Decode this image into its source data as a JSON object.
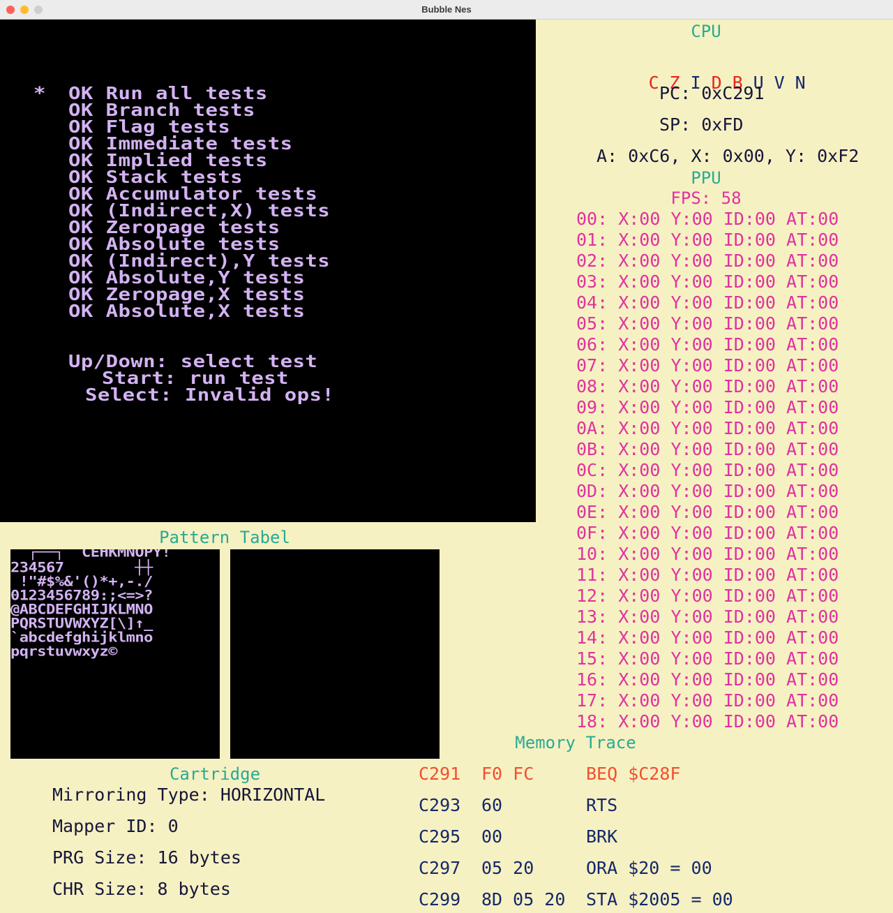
{
  "window": {
    "title": "Bubble Nes",
    "colors": {
      "close": "#ff5f57",
      "minimize": "#febc2e",
      "zoom": "#cfcfcf"
    }
  },
  "game_screen": {
    "cursor": "*",
    "test_lines": [
      "OK Run all tests",
      "OK Branch tests",
      "OK Flag tests",
      "OK Immediate tests",
      "OK Implied tests",
      "OK Stack tests",
      "OK Accumulator tests",
      "OK (Indirect,X) tests",
      "OK Zeropage tests",
      "OK Absolute tests",
      "OK (Indirect),Y tests",
      "OK Absolute,Y tests",
      "OK Zeropage,X tests",
      "OK Absolute,X tests"
    ],
    "help_lines": [
      "Up/Down: select test",
      "Start: run test",
      "Select: Invalid ops!"
    ]
  },
  "cpu": {
    "heading": "CPU",
    "flags": [
      {
        "label": "C",
        "color": "#e8231b"
      },
      {
        "label": "Z",
        "color": "#e8231b"
      },
      {
        "label": "I",
        "color": "#15286b"
      },
      {
        "label": "D",
        "color": "#e8231b"
      },
      {
        "label": "B",
        "color": "#e8231b"
      },
      {
        "label": "U",
        "color": "#15286b"
      },
      {
        "label": "V",
        "color": "#15286b"
      },
      {
        "label": "N",
        "color": "#15286b"
      }
    ],
    "pc": "PC: 0xC291",
    "sp": "SP: 0xFD",
    "registers": "A: 0xC6, X: 0x00, Y: 0xF2"
  },
  "ppu": {
    "heading": "PPU",
    "fps": "FPS: 58",
    "sprites": [
      "00: X:00 Y:00 ID:00 AT:00",
      "01: X:00 Y:00 ID:00 AT:00",
      "02: X:00 Y:00 ID:00 AT:00",
      "03: X:00 Y:00 ID:00 AT:00",
      "04: X:00 Y:00 ID:00 AT:00",
      "05: X:00 Y:00 ID:00 AT:00",
      "06: X:00 Y:00 ID:00 AT:00",
      "07: X:00 Y:00 ID:00 AT:00",
      "08: X:00 Y:00 ID:00 AT:00",
      "09: X:00 Y:00 ID:00 AT:00",
      "0A: X:00 Y:00 ID:00 AT:00",
      "0B: X:00 Y:00 ID:00 AT:00",
      "0C: X:00 Y:00 ID:00 AT:00",
      "0D: X:00 Y:00 ID:00 AT:00",
      "0E: X:00 Y:00 ID:00 AT:00",
      "0F: X:00 Y:00 ID:00 AT:00",
      "10: X:00 Y:00 ID:00 AT:00",
      "11: X:00 Y:00 ID:00 AT:00",
      "12: X:00 Y:00 ID:00 AT:00",
      "13: X:00 Y:00 ID:00 AT:00",
      "14: X:00 Y:00 ID:00 AT:00",
      "15: X:00 Y:00 ID:00 AT:00",
      "16: X:00 Y:00 ID:00 AT:00",
      "17: X:00 Y:00 ID:00 AT:00",
      "18: X:00 Y:00 ID:00 AT:00"
    ]
  },
  "pattern_table": {
    "heading": "Pattern Tabel",
    "left_rows": [
      "  ┌──┐  CEHKMNOPY!",
      "234567        ┼┼",
      " !\"#$%&'()*+,-./",
      "0123456789:;<=>?",
      "@ABCDEFGHIJKLMNO",
      "PQRSTUVWXYZ[\\]↑_",
      "`abcdefghijklmno",
      "pqrstuvwxyz©"
    ]
  },
  "cartridge": {
    "heading": "Cartridge",
    "mirroring": "Mirroring Type: HORIZONTAL",
    "mapper": "Mapper ID: 0",
    "prg": "PRG Size: 16 bytes",
    "chr": "CHR Size: 8 bytes"
  },
  "memory_trace": {
    "heading": "Memory Trace",
    "current_color": "#f0502e",
    "default_color": "#15286b",
    "rows": [
      {
        "addr": "C291",
        "bytes": "F0 FC",
        "instr": "BEQ $C28F",
        "current": true
      },
      {
        "addr": "C293",
        "bytes": "60",
        "instr": "RTS",
        "current": false
      },
      {
        "addr": "C295",
        "bytes": "00",
        "instr": "BRK",
        "current": false
      },
      {
        "addr": "C297",
        "bytes": "05 20",
        "instr": "ORA $20 = 00",
        "current": false
      },
      {
        "addr": "C299",
        "bytes": "8D 05 20",
        "instr": "STA $2005 = 00",
        "current": false
      }
    ]
  }
}
